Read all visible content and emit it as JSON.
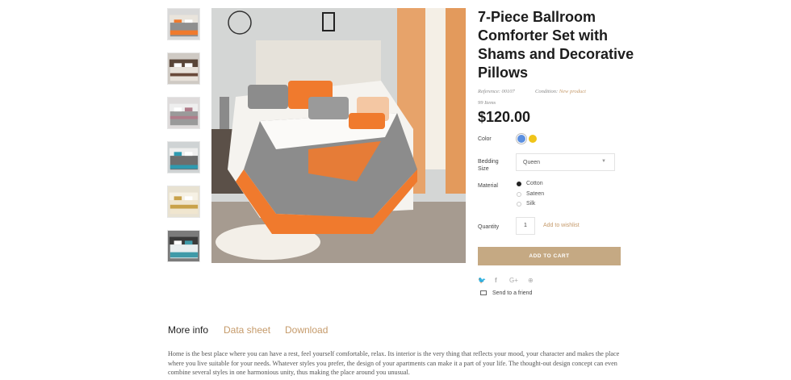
{
  "gallery": {
    "thumbnails": [
      {
        "name": "thumb-1",
        "accent": "#f07a2d",
        "body": "#8f8f8f"
      },
      {
        "name": "thumb-2",
        "accent": "#6a4a3a",
        "body": "#e8e2da"
      },
      {
        "name": "thumb-3",
        "accent": "#b07c8a",
        "body": "#9a9a9a"
      },
      {
        "name": "thumb-4",
        "accent": "#2e9ab0",
        "body": "#6d6d6d"
      },
      {
        "name": "thumb-5",
        "accent": "#c9a24a",
        "body": "#f0e6cf"
      },
      {
        "name": "thumb-6",
        "accent": "#3f9aa8",
        "body": "#4a4a4a"
      }
    ]
  },
  "product": {
    "title": "7-Piece Ballroom Comforter Set with Shams and Decorative Pillows",
    "reference_label": "Reference:",
    "reference_value": "00107",
    "condition_label": "Condition:",
    "condition_value": "New product",
    "items_count": "99 Items",
    "price": "$120.00"
  },
  "options": {
    "color_label": "Color",
    "colors": [
      "#5b8fe0",
      "#f0c419"
    ],
    "bedding_label_line1": "Bedding",
    "bedding_label_line2": "Size",
    "bedding_value": "Queen",
    "material_label": "Material",
    "materials": [
      "Cotton",
      "Sateen",
      "Silk"
    ],
    "material_selected": "Cotton",
    "quantity_label": "Quantity",
    "quantity_value": "1",
    "wishlist_label": "Add to wishlist",
    "cart_label": "ADD TO CART"
  },
  "share": {
    "icons": [
      "twitter-icon",
      "facebook-icon",
      "google-plus-icon",
      "pinterest-icon"
    ],
    "glyphs": [
      "🐦",
      "f",
      "G+",
      "⊕"
    ],
    "send_label": "Send to a friend"
  },
  "tabs": [
    {
      "label": "More info",
      "active": true
    },
    {
      "label": "Data sheet",
      "active": false
    },
    {
      "label": "Download",
      "active": false
    }
  ],
  "description": "Home is the best place where you can have a rest, feel yourself comfortable, relax. Its interior is the very thing that reflects your mood, your character and makes the place where you live suitable for your needs. Whatever styles you prefer, the design of your apartments can make it a part of your life. The thought-out design concept can even combine several styles in one harmonious unity, thus making the place around you unusual.",
  "colors": {
    "accent": "#c59a6a",
    "button": "#c5a983",
    "text": "#222222"
  }
}
